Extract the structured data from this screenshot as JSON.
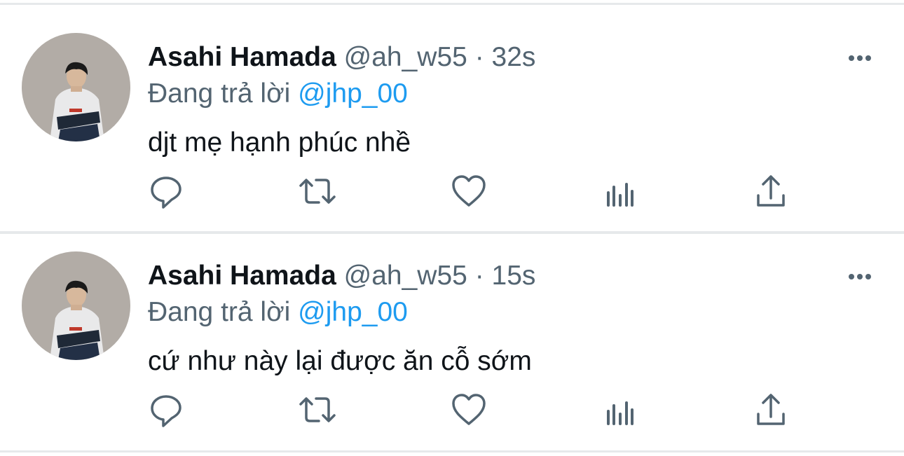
{
  "tweets": [
    {
      "display_name": "Asahi Hamada",
      "handle": "@ah_w55",
      "separator": "·",
      "time": "32s",
      "reply_prefix": "Đang trả lời",
      "reply_to": "@jhp_00",
      "text": "djt mẹ hạnh phúc nhề"
    },
    {
      "display_name": "Asahi Hamada",
      "handle": "@ah_w55",
      "separator": "·",
      "time": "15s",
      "reply_prefix": "Đang trả lời",
      "reply_to": "@jhp_00",
      "text": "cứ như này lại được ăn cỗ sớm"
    }
  ],
  "icons": [
    "more-icon",
    "reply-icon",
    "retweet-icon",
    "like-icon",
    "analytics-icon",
    "share-icon"
  ],
  "colors": {
    "text": "#0f1419",
    "secondary": "#536471",
    "link": "#1d9bf0",
    "divider": "#e6e9eb"
  }
}
